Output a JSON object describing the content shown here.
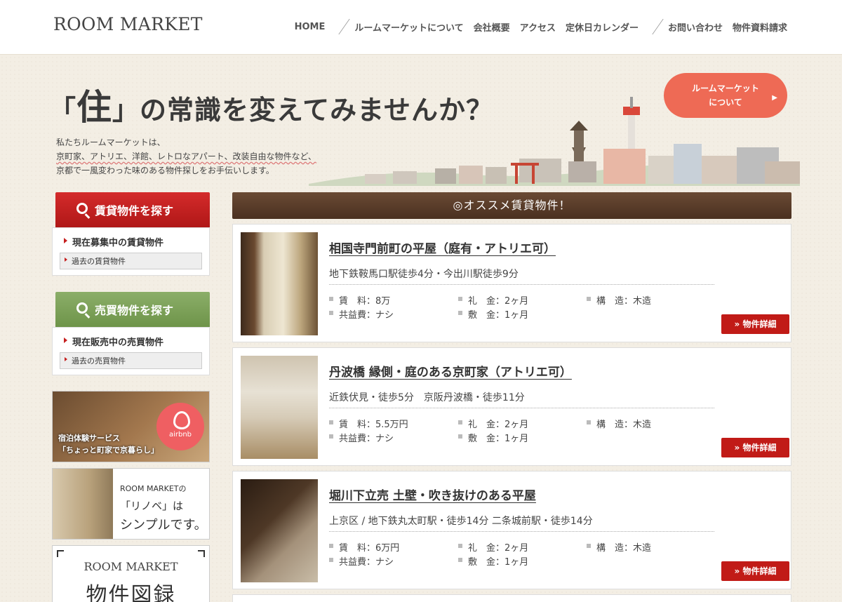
{
  "header": {
    "logo": "ROOM MARKET",
    "nav": [
      {
        "label": "HOME"
      },
      {
        "label": "ルームマーケットについて"
      },
      {
        "label": "会社概要"
      },
      {
        "label": "アクセス"
      },
      {
        "label": "定休日カレンダー"
      },
      {
        "label": "お問い合わせ"
      },
      {
        "label": "物件資料請求"
      }
    ]
  },
  "hero": {
    "title_open": "「",
    "title_kanji": "住",
    "title_close": "」",
    "title_rest": "の常識を変えてみませんか？",
    "lines": [
      "私たちルームマーケットは、",
      "京町家、アトリエ、洋館、レトロなアパート、改装自由な物件など、",
      "京都で一風変わった味のある物件探しをお手伝いします。"
    ],
    "about_button_line1": "ルームマーケット",
    "about_button_line2": "について"
  },
  "sidebar": {
    "rent": {
      "button": "賃貸物件を探す",
      "current": "現在募集中の賃貸物件",
      "past": "過去の賃貸物件"
    },
    "sale": {
      "button": "売買物件を探す",
      "current": "現在販売中の売買物件",
      "past": "過去の売買物件"
    },
    "airbnb": {
      "line1": "宿泊体験サービス",
      "line2": "「ちょっと町家で京暮らし」",
      "logo": "airbnb"
    },
    "renov": {
      "line1": "ROOM MARKETの",
      "line2": "「リノベ」は",
      "line3": "シンプルです。"
    },
    "zuroku": {
      "line1": "ROOM MARKET",
      "line2": "物件図録"
    }
  },
  "main": {
    "section_title": "◎オススメ賃貸物件！",
    "detail_label": "» 物件詳細",
    "listings": [
      {
        "title": "相国寺門前町の平屋（庭有・アトリエ可）",
        "station": "地下鉄鞍馬口駅徒歩4分・今出川駅徒歩9分",
        "rent": "賃　料：8万",
        "kyoeki": "共益費：ナシ",
        "reikin": "礼　金：2ヶ月",
        "shikikin": "敷　金：1ヶ月",
        "kozo": "構　造：木造"
      },
      {
        "title": "丹波橋 縁側・庭のある京町家（アトリエ可）",
        "station": "近鉄伏見・徒歩5分　京阪丹波橋・徒歩11分",
        "rent": "賃　料：5.5万円",
        "kyoeki": "共益費：ナシ",
        "reikin": "礼　金：2ヶ月",
        "shikikin": "敷　金：1ヶ月",
        "kozo": "構　造：木造"
      },
      {
        "title": "堀川下立売 土壁・吹き抜けのある平屋",
        "station": "上京区 / 地下鉄丸太町駅・徒歩14分 二条城前駅・徒歩14分",
        "rent": "賃　料：6万円",
        "kyoeki": "共益費：ナシ",
        "reikin": "礼　金：2ヶ月",
        "shikikin": "敷　金：1ヶ月",
        "kozo": "構　造：木造"
      }
    ]
  }
}
